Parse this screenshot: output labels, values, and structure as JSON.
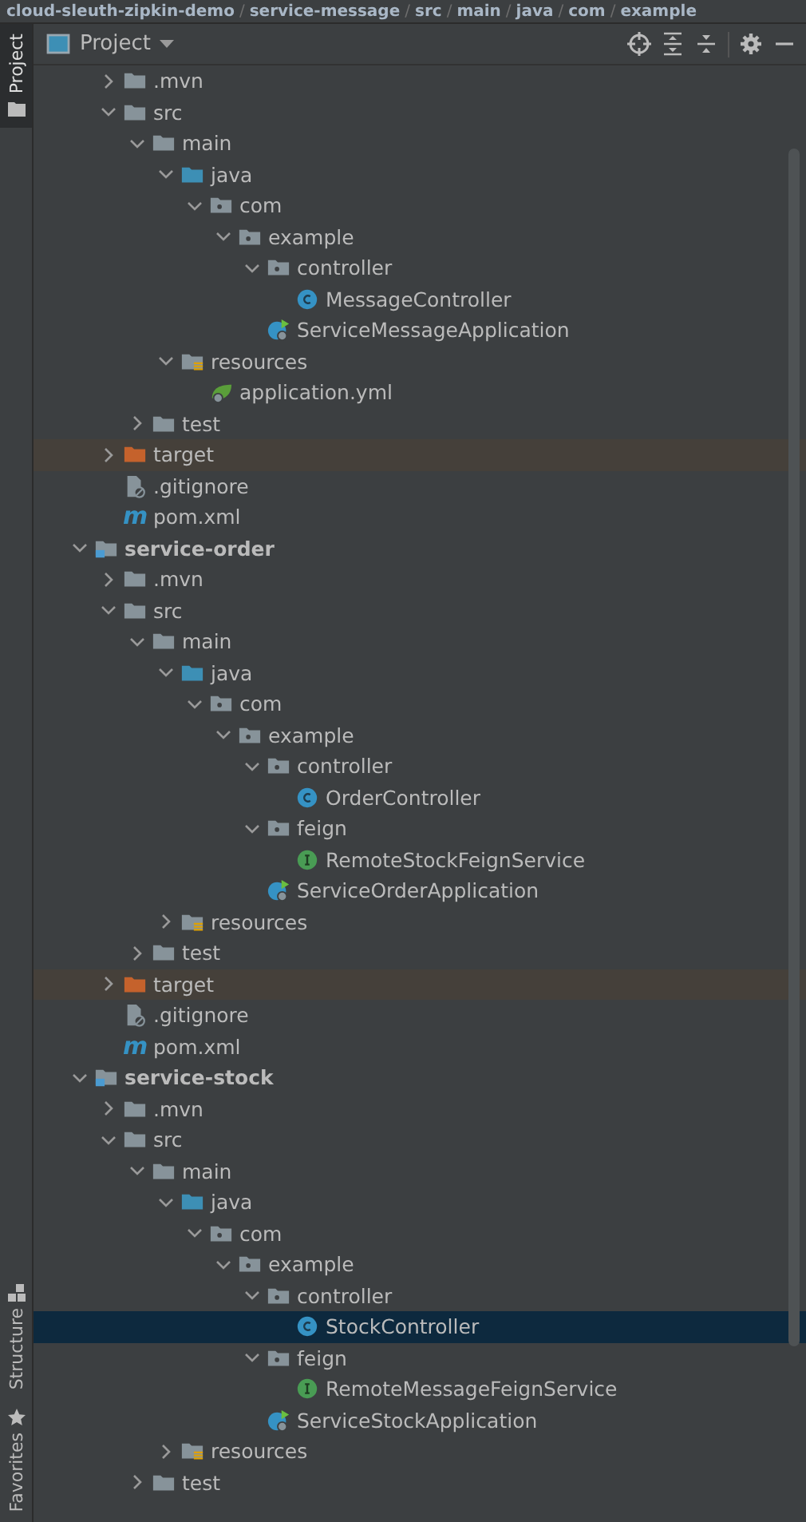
{
  "breadcrumb": {
    "separator": "/",
    "items": [
      "cloud-sleuth-zipkin-demo",
      "service-message",
      "src",
      "main",
      "java",
      "com",
      "example"
    ]
  },
  "side_tabs": [
    {
      "label": "Project",
      "selected": true,
      "kind": "project"
    },
    {
      "label": "Structure",
      "selected": false,
      "kind": "structure"
    },
    {
      "label": "Favorites",
      "selected": false,
      "kind": "favorites"
    }
  ],
  "panel": {
    "title": "Project"
  },
  "tree": [
    {
      "kind": "offscreen",
      "children": [
        {
          "label": ".mvn",
          "kind": "folder",
          "expanded": false,
          "selected": false
        },
        {
          "label": "src",
          "kind": "folder",
          "expanded": true,
          "selected": false,
          "children": [
            {
              "label": "main",
              "kind": "folder",
              "expanded": true,
              "selected": false,
              "children": [
                {
                  "label": "java",
                  "kind": "source",
                  "expanded": true,
                  "selected": false,
                  "children": [
                    {
                      "label": "com",
                      "kind": "package",
                      "expanded": true,
                      "selected": false,
                      "children": [
                        {
                          "label": "example",
                          "kind": "package",
                          "expanded": true,
                          "selected": false,
                          "children": [
                            {
                              "label": "controller",
                              "kind": "package",
                              "expanded": true,
                              "selected": false,
                              "children": [
                                {
                                  "label": "MessageController",
                                  "kind": "class",
                                  "selected": false
                                }
                              ]
                            },
                            {
                              "label": "ServiceMessageApplication",
                              "kind": "app",
                              "selected": false
                            }
                          ]
                        }
                      ]
                    }
                  ]
                },
                {
                  "label": "resources",
                  "kind": "resources",
                  "expanded": true,
                  "selected": false,
                  "children": [
                    {
                      "label": "application.yml",
                      "kind": "yml",
                      "selected": false
                    }
                  ]
                }
              ]
            },
            {
              "label": "test",
              "kind": "folder",
              "expanded": false,
              "selected": false
            }
          ]
        },
        {
          "label": "target",
          "kind": "excluded",
          "expanded": false,
          "selected": false
        },
        {
          "label": ".gitignore",
          "kind": "gitignore",
          "selected": false
        },
        {
          "label": "pom.xml",
          "kind": "maven",
          "icon_text": "m",
          "selected": false
        }
      ]
    },
    {
      "label": "service-order",
      "kind": "module",
      "expanded": true,
      "selected": false,
      "children": [
        {
          "label": ".mvn",
          "kind": "folder",
          "expanded": false,
          "selected": false
        },
        {
          "label": "src",
          "kind": "folder",
          "expanded": true,
          "selected": false,
          "children": [
            {
              "label": "main",
              "kind": "folder",
              "expanded": true,
              "selected": false,
              "children": [
                {
                  "label": "java",
                  "kind": "source",
                  "expanded": true,
                  "selected": false,
                  "children": [
                    {
                      "label": "com",
                      "kind": "package",
                      "expanded": true,
                      "selected": false,
                      "children": [
                        {
                          "label": "example",
                          "kind": "package",
                          "expanded": true,
                          "selected": false,
                          "children": [
                            {
                              "label": "controller",
                              "kind": "package",
                              "expanded": true,
                              "selected": false,
                              "children": [
                                {
                                  "label": "OrderController",
                                  "kind": "class",
                                  "selected": false
                                }
                              ]
                            },
                            {
                              "label": "feign",
                              "kind": "package",
                              "expanded": true,
                              "selected": false,
                              "children": [
                                {
                                  "label": "RemoteStockFeignService",
                                  "kind": "interface",
                                  "selected": false
                                }
                              ]
                            },
                            {
                              "label": "ServiceOrderApplication",
                              "kind": "app",
                              "selected": false
                            }
                          ]
                        }
                      ]
                    }
                  ]
                },
                {
                  "label": "resources",
                  "kind": "resources",
                  "expanded": false,
                  "selected": false
                }
              ]
            },
            {
              "label": "test",
              "kind": "folder",
              "expanded": false,
              "selected": false
            }
          ]
        },
        {
          "label": "target",
          "kind": "excluded",
          "expanded": false,
          "selected": false
        },
        {
          "label": ".gitignore",
          "kind": "gitignore",
          "selected": false
        },
        {
          "label": "pom.xml",
          "kind": "maven",
          "icon_text": "m",
          "selected": false
        }
      ]
    },
    {
      "label": "service-stock",
      "kind": "module",
      "expanded": true,
      "selected": false,
      "children": [
        {
          "label": ".mvn",
          "kind": "folder",
          "expanded": false,
          "selected": false
        },
        {
          "label": "src",
          "kind": "folder",
          "expanded": true,
          "selected": false,
          "children": [
            {
              "label": "main",
              "kind": "folder",
              "expanded": true,
              "selected": false,
              "children": [
                {
                  "label": "java",
                  "kind": "source",
                  "expanded": true,
                  "selected": false,
                  "children": [
                    {
                      "label": "com",
                      "kind": "package",
                      "expanded": true,
                      "selected": false,
                      "children": [
                        {
                          "label": "example",
                          "kind": "package",
                          "expanded": true,
                          "selected": false,
                          "children": [
                            {
                              "label": "controller",
                              "kind": "package",
                              "expanded": true,
                              "selected": false,
                              "children": [
                                {
                                  "label": "StockController",
                                  "kind": "class",
                                  "selected": true
                                }
                              ]
                            },
                            {
                              "label": "feign",
                              "kind": "package",
                              "expanded": true,
                              "selected": false,
                              "children": [
                                {
                                  "label": "RemoteMessageFeignService",
                                  "kind": "interface",
                                  "selected": false
                                }
                              ]
                            },
                            {
                              "label": "ServiceStockApplication",
                              "kind": "app",
                              "selected": false
                            }
                          ]
                        }
                      ]
                    }
                  ]
                },
                {
                  "label": "resources",
                  "kind": "resources",
                  "expanded": false,
                  "selected": false
                }
              ]
            },
            {
              "label": "test",
              "kind": "folder",
              "expanded": false,
              "selected": false
            }
          ]
        }
      ]
    }
  ]
}
